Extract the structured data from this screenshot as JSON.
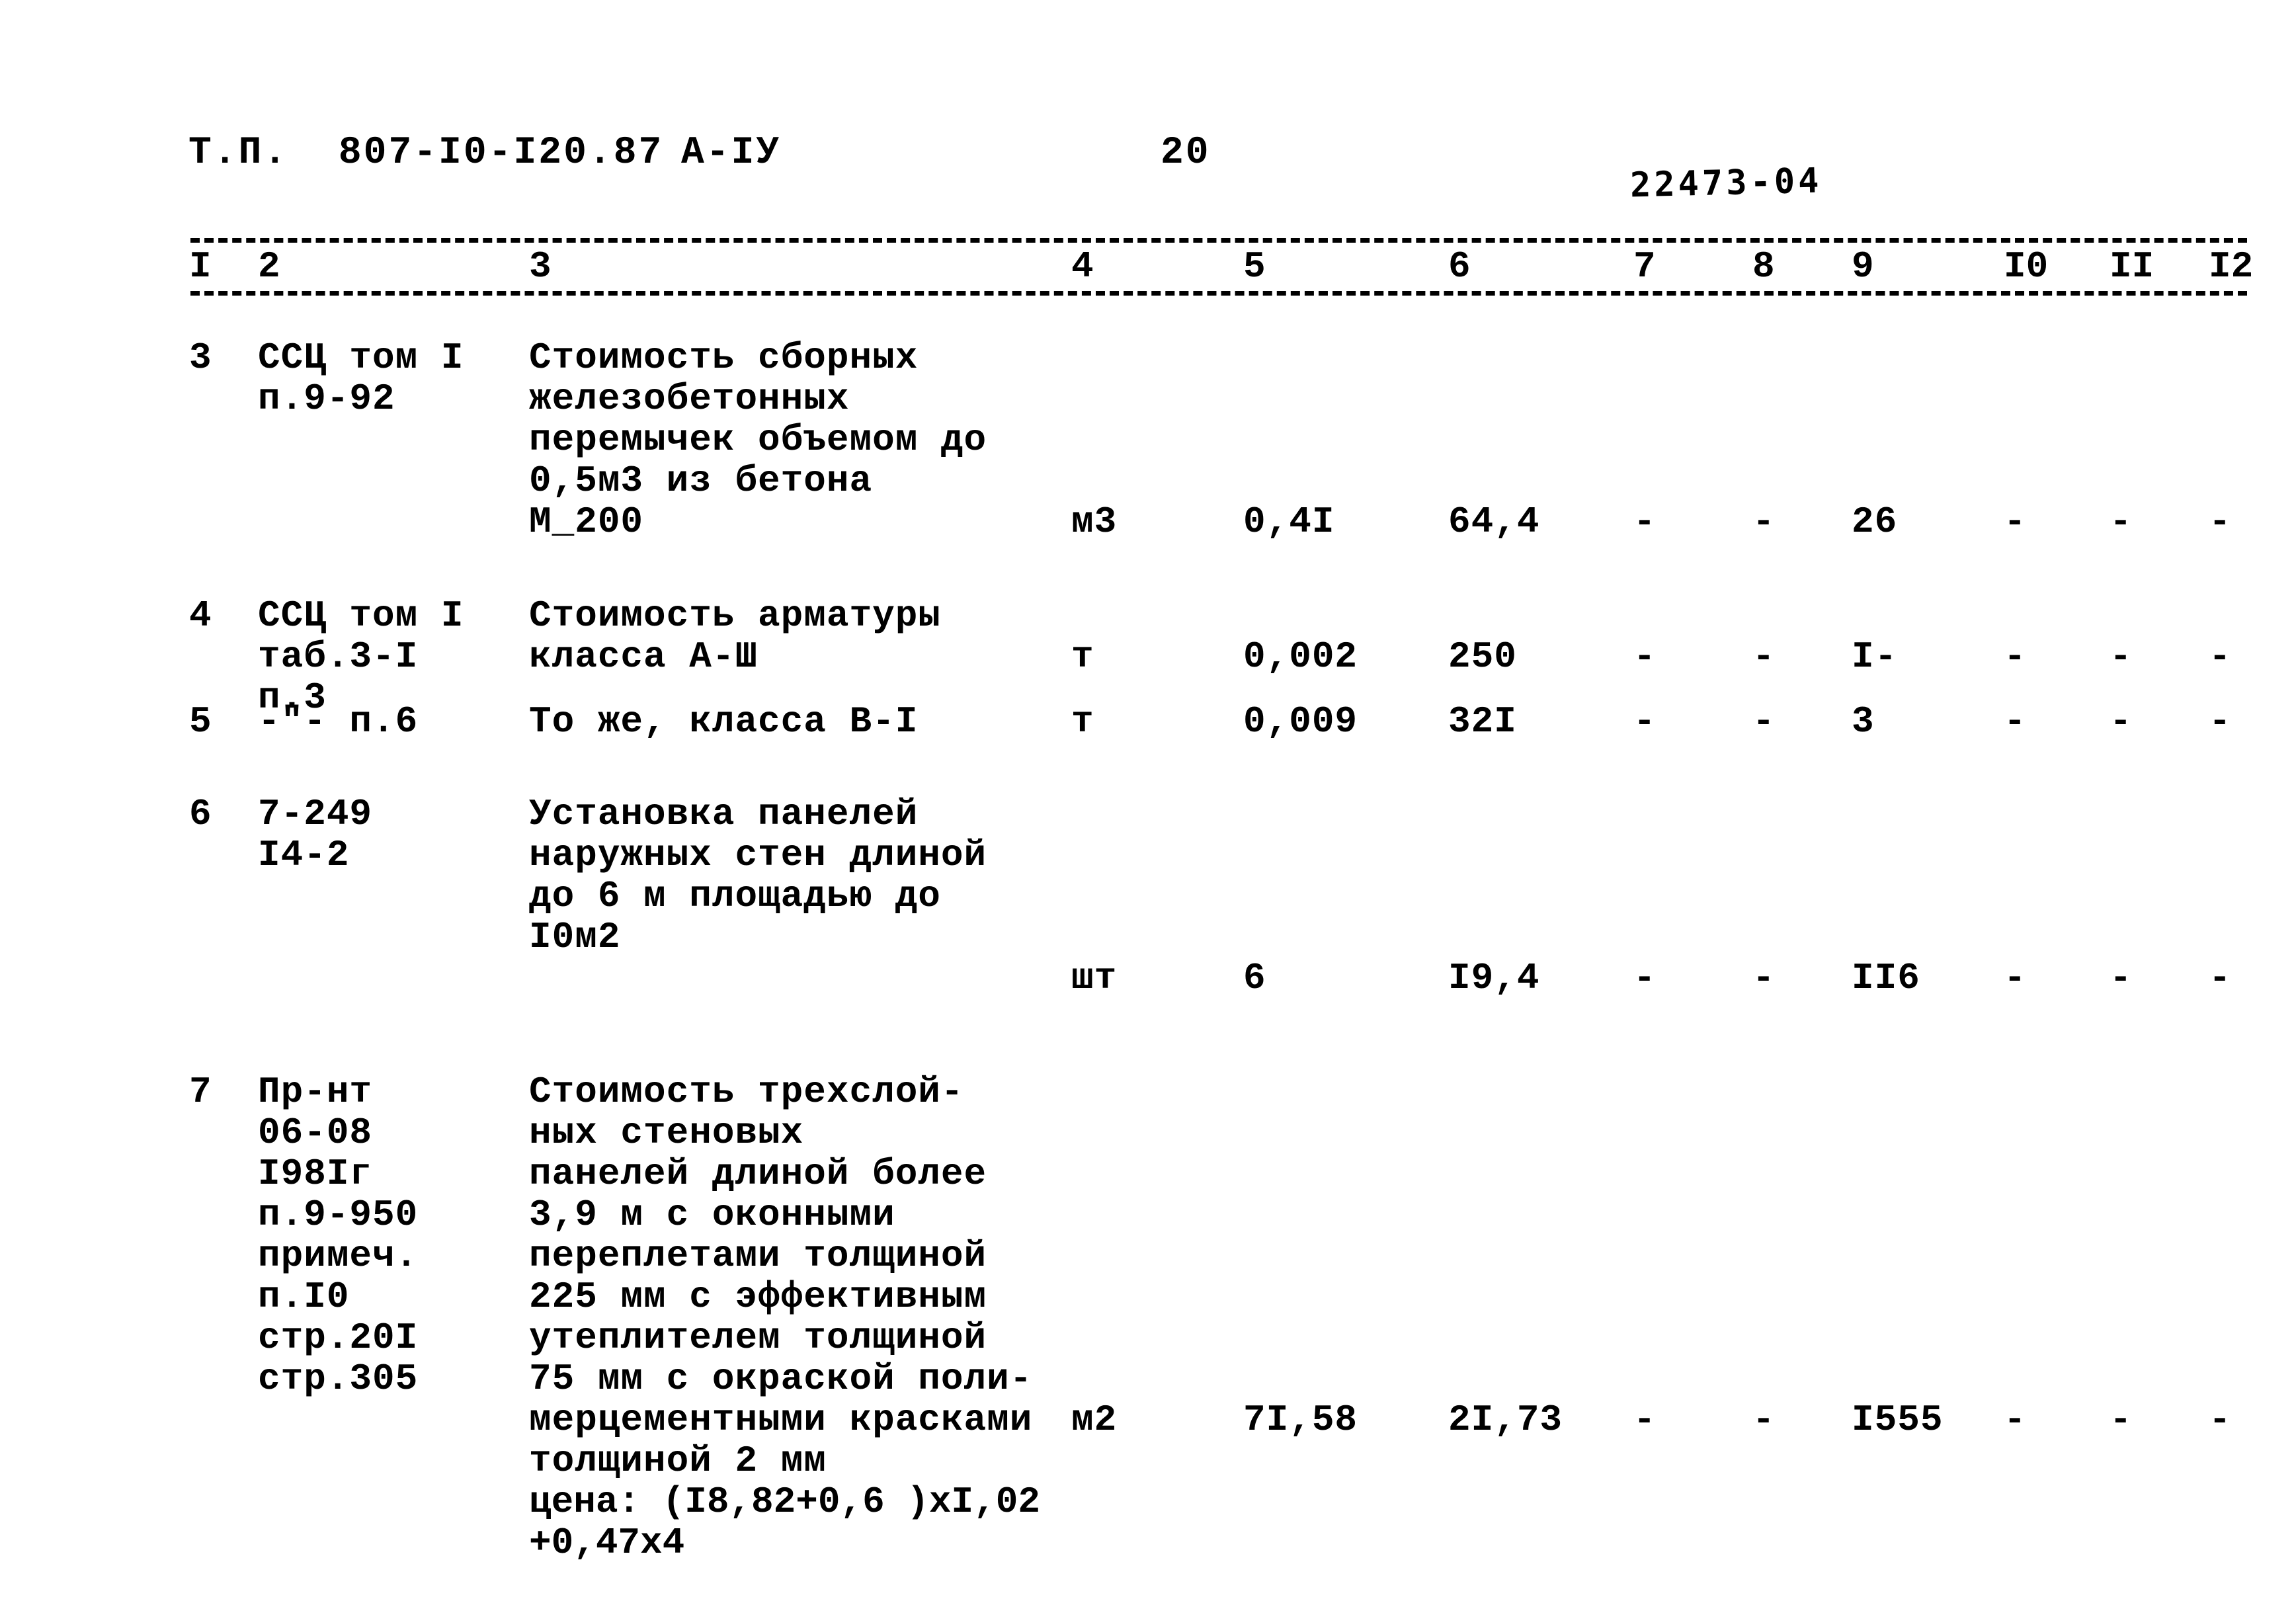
{
  "header": {
    "doc_code": "Т.П.  807-I0-I20.87",
    "variant": "А-IУ",
    "page_number": "20",
    "archive_number": "22473-04"
  },
  "table": {
    "column_headers": [
      "I",
      "2",
      "3",
      "4",
      "5",
      "6",
      "7",
      "8",
      "9",
      "I0",
      "II",
      "I2"
    ],
    "rows": [
      {
        "num": "3",
        "code": "ССЦ том I\nп.9-92",
        "description": "Стоимость сборных\nжелезобетонных\nперемычек объемом до\n0,5м3 из бетона\nМ_200",
        "unit": "м3",
        "qty": "0,4I",
        "price": "64,4",
        "c7": "-",
        "c8": "-",
        "c9": "26",
        "c10": "-",
        "c11": "-",
        "c12": "-"
      },
      {
        "num": "4",
        "code": "ССЦ том I\nтаб.3-I\nп.3",
        "description": "Стоимость арматуры\nкласса А-Ш",
        "unit": "т",
        "qty": "0,002",
        "price": "250",
        "c7": "-",
        "c8": "-",
        "c9": "I-",
        "c10": "-",
        "c11": "-",
        "c12": "-"
      },
      {
        "num": "5",
        "code": "-\"- п.6",
        "description": "То же, класса В-I",
        "unit": "т",
        "qty": "0,009",
        "price": "32I",
        "c7": "-",
        "c8": "-",
        "c9": "3",
        "c10": "-",
        "c11": "-",
        "c12": "-"
      },
      {
        "num": "6",
        "code": "7-249\nI4-2",
        "description": "Установка панелей\nнаружных стен длиной\nдо 6 м площадью до\nI0м2",
        "unit": "шт",
        "qty": "6",
        "price": "I9,4",
        "c7": "-",
        "c8": "-",
        "c9": "II6",
        "c10": "-",
        "c11": "-",
        "c12": "-"
      },
      {
        "num": "7",
        "code": "Пр-нт\n06-08\nI98Iг\nп.9-950\nпримеч.\nп.I0\nстр.20I\nстр.305",
        "description": "Стоимость трехслой-\nных стеновых\nпанелей длиной более\n3,9 м с оконными\nпереплетами толщиной\n225 мм с эффективным\nутеплителем толщиной\n75 мм с окраской поли-\nмерцементными красками\nтолщиной 2 мм",
        "price_formula": "цена: (I8,82+0,6 )xI,02\n      +0,47x4",
        "unit": "м2",
        "qty": "7I,58",
        "price": "2I,73",
        "c7": "-",
        "c8": "-",
        "c9": "I555",
        "c10": "-",
        "c11": "-",
        "c12": "-"
      }
    ]
  }
}
